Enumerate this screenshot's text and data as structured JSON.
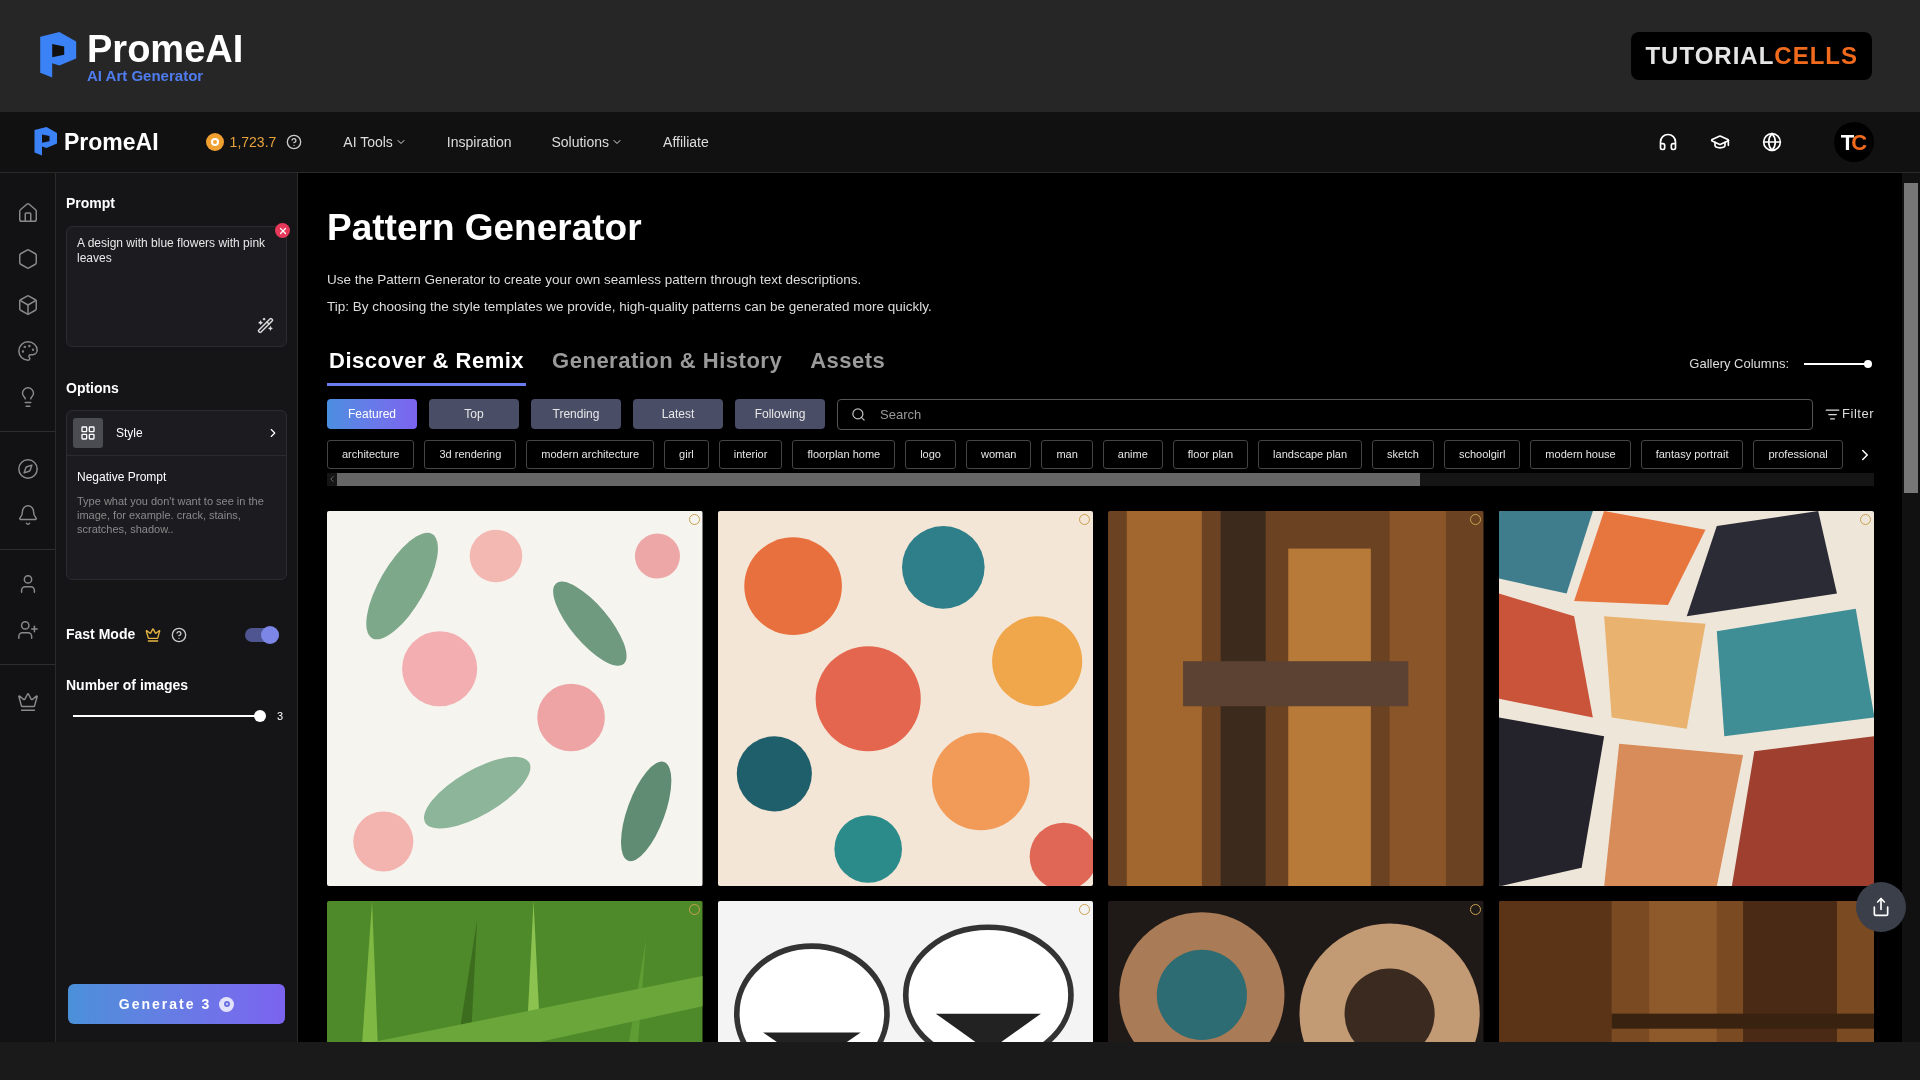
{
  "banner": {
    "brand": "PromeAI",
    "tagline": "AI Art Generator",
    "badge_left": "TUTORIAL",
    "badge_right": "CELLS"
  },
  "nav": {
    "brand": "PromeAI",
    "credits": "1,723.7",
    "items": [
      {
        "label": "AI Tools",
        "dropdown": true
      },
      {
        "label": "Inspiration",
        "dropdown": false
      },
      {
        "label": "Solutions",
        "dropdown": true
      },
      {
        "label": "Affiliate",
        "dropdown": false
      }
    ],
    "avatar_left": "T",
    "avatar_right": "C"
  },
  "panel": {
    "prompt_label": "Prompt",
    "prompt_value": "A design with blue flowers with pink leaves",
    "options_label": "Options",
    "style_label": "Style",
    "negative_label": "Negative Prompt",
    "negative_placeholder": "Type what you don't want to see in the image, for example. crack, stains, scratches, shadow..",
    "fast_mode": {
      "label": "Fast Mode",
      "on": true
    },
    "images": {
      "label": "Number of images",
      "level": 1,
      "reading": "3"
    },
    "generate": "Generate 3"
  },
  "main": {
    "title": "Pattern Generator",
    "description": [
      "Use the Pattern Generator to create your own seamless pattern through text descriptions.",
      "Tip: By choosing the style templates we provide, high-quality patterns can be generated more quickly."
    ],
    "tabs": [
      {
        "label": "Discover & Remix",
        "selected": true
      },
      {
        "label": "Generation & History",
        "selected": false
      },
      {
        "label": "Assets",
        "selected": false
      }
    ],
    "gallery_columns": {
      "label": "Gallery Columns:",
      "level": 1
    },
    "filters": [
      {
        "label": "Featured",
        "selected": true
      },
      {
        "label": "Top",
        "selected": false
      },
      {
        "label": "Trending",
        "selected": false
      },
      {
        "label": "Latest",
        "selected": false
      },
      {
        "label": "Following",
        "selected": false
      }
    ],
    "search": {
      "placeholder": "Search"
    },
    "filter_button": "Filter",
    "tags": [
      "architecture",
      "3d rendering",
      "modern architecture",
      "girl",
      "interior",
      "floorplan home",
      "logo",
      "woman",
      "man",
      "anime",
      "floor plan",
      "landscape plan",
      "sketch",
      "schoolgirl",
      "modern house",
      "fantasy portrait",
      "professional"
    ],
    "gallery": [
      {
        "kind": "picture"
      },
      {
        "kind": "picture"
      },
      {
        "kind": "picture"
      },
      {
        "kind": "picture"
      },
      {
        "kind": "picture"
      },
      {
        "kind": "picture"
      },
      {
        "kind": "picture"
      },
      {
        "kind": "picture"
      }
    ]
  }
}
